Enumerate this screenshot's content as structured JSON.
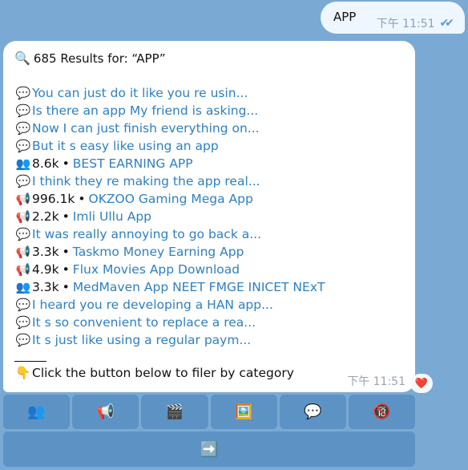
{
  "outgoing": {
    "text": "APP",
    "time": "下午 11:51",
    "ticks": "✔✔"
  },
  "incoming": {
    "results_icon": "🔍",
    "results_label": "685 Results for: “APP”",
    "rows": [
      {
        "icon": "💬",
        "count": "",
        "text": "You can just do it like you re usin..."
      },
      {
        "icon": "💬",
        "count": "",
        "text": "Is there an app My friend is asking..."
      },
      {
        "icon": "💬",
        "count": "",
        "text": "Now I can just finish everything on..."
      },
      {
        "icon": "💬",
        "count": "",
        "text": "But it s easy like using an app"
      },
      {
        "icon": "👥",
        "count": "8.6k",
        "text": "BEST EARNING APP"
      },
      {
        "icon": "💬",
        "count": "",
        "text": "I think they re making the app real..."
      },
      {
        "icon": "📢",
        "count": "996.1k",
        "text": "OKZOO Gaming Mega App"
      },
      {
        "icon": "📢",
        "count": "2.2k",
        "text": "Imli Ullu App"
      },
      {
        "icon": "💬",
        "count": "",
        "text": "It was really annoying to go back a..."
      },
      {
        "icon": "📢",
        "count": "3.3k",
        "text": "Taskmo Money Earning App"
      },
      {
        "icon": "📢",
        "count": "4.9k",
        "text": "Flux Movies App Download"
      },
      {
        "icon": "👥",
        "count": "3.3k",
        "text": "MedMaven App NEET FMGE INICET NExT"
      },
      {
        "icon": "💬",
        "count": "",
        "text": "I heard you re developing a HAN app..."
      },
      {
        "icon": "💬",
        "count": "",
        "text": "It s so convenient to replace a rea..."
      },
      {
        "icon": "💬",
        "count": "",
        "text": "It s just like using a regular paym..."
      }
    ],
    "separator": "•",
    "footer_icon": "👇",
    "footer_text": "Click the button below to filer by category",
    "time": "下午 11:51",
    "reaction": "❤️"
  },
  "keyboard": {
    "row1": [
      {
        "icon": "👥",
        "name": "groups-filter"
      },
      {
        "icon": "📢",
        "name": "channels-filter"
      },
      {
        "icon": "🎬",
        "name": "videos-filter"
      },
      {
        "icon": "🖼️",
        "name": "images-filter"
      },
      {
        "icon": "💬",
        "name": "messages-filter"
      },
      {
        "icon": "🔞",
        "name": "adult-filter"
      }
    ],
    "row2_icon": "➡️"
  }
}
